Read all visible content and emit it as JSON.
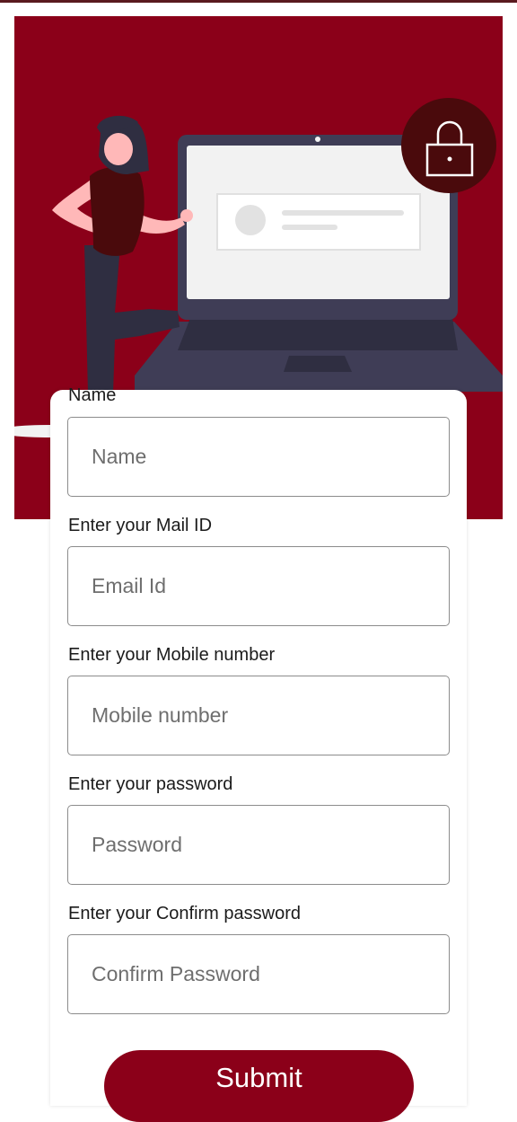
{
  "colors": {
    "brand": "#8b0019",
    "dark_accent": "#4a0a0c",
    "laptop_body": "#3f3d56",
    "screen": "#f2f2f2"
  },
  "hero": {
    "illustration": "woman-with-laptop-illustration",
    "lock_icon": "padlock-icon"
  },
  "form": {
    "name": {
      "label": "Name",
      "placeholder": "Name",
      "value": ""
    },
    "email": {
      "label": "Enter your Mail ID",
      "placeholder": "Email Id",
      "value": ""
    },
    "mobile": {
      "label": "Enter your Mobile number",
      "placeholder": "Mobile number",
      "value": ""
    },
    "password": {
      "label": "Enter your password",
      "placeholder": "Password",
      "value": ""
    },
    "confirm_password": {
      "label": "Enter your Confirm password",
      "placeholder": "Confirm Password",
      "value": ""
    },
    "submit_label": "Submit"
  }
}
